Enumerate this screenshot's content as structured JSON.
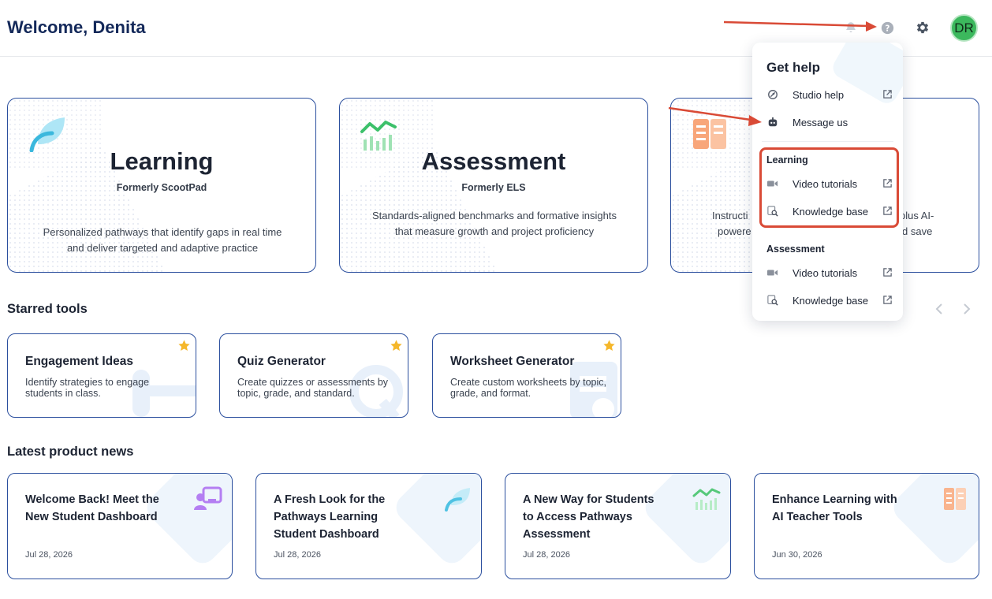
{
  "header": {
    "welcome": "Welcome, Denita",
    "avatar_initials": "DR"
  },
  "products": [
    {
      "title": "Learning",
      "subtitle": "Formerly ScootPad",
      "description": "Personalized pathways that identify gaps in real time and deliver targeted and adaptive practice",
      "icon": "leaf-icon"
    },
    {
      "title": "Assessment",
      "subtitle": "Formerly ELS",
      "description": "Standards-aligned benchmarks and formative insights that measure growth and project proficiency",
      "icon": "chart-icon"
    },
    {
      "title": "",
      "subtitle": "",
      "description_left": "Instructi",
      "description_left2": "powere",
      "description_right": "plus AI-",
      "description_right2": "d save",
      "icon": "book-icon"
    }
  ],
  "starred": {
    "title": "Starred tools",
    "tools": [
      {
        "title": "Engagement Ideas",
        "description": "Identify strategies to engage students in class."
      },
      {
        "title": "Quiz Generator",
        "description": "Create quizzes or assessments by topic, grade, and standard."
      },
      {
        "title": "Worksheet Generator",
        "description": "Create custom worksheets by topic, grade, and format."
      }
    ]
  },
  "news": {
    "title": "Latest product news",
    "items": [
      {
        "title": "Welcome Back! Meet the New Student Dashboard",
        "date": "Jul 28, 2026",
        "icon": "presenter-icon"
      },
      {
        "title": "A Fresh Look for the Pathways Learning Student Dashboard",
        "date": "Jul 28, 2026",
        "icon": "leaf-icon"
      },
      {
        "title": "A New Way for Students to Access Pathways Assessment",
        "date": "Jul 28, 2026",
        "icon": "chart-icon"
      },
      {
        "title": "Enhance Learning with AI Teacher Tools",
        "date": "Jun 30, 2026",
        "icon": "book-icon"
      }
    ]
  },
  "help_menu": {
    "title": "Get help",
    "studio_help": "Studio help",
    "message_us": "Message us",
    "learning_group": "Learning",
    "learning_video": "Video tutorials",
    "learning_kb": "Knowledge base",
    "assessment_group": "Assessment",
    "assessment_video": "Video tutorials",
    "assessment_kb": "Knowledge base"
  },
  "colors": {
    "brand_navy": "#14295a",
    "card_border": "#2b4f9e",
    "avatar_green": "#3cb85d",
    "star_yellow": "#f5b72b",
    "annotation_red": "#d94a36"
  }
}
